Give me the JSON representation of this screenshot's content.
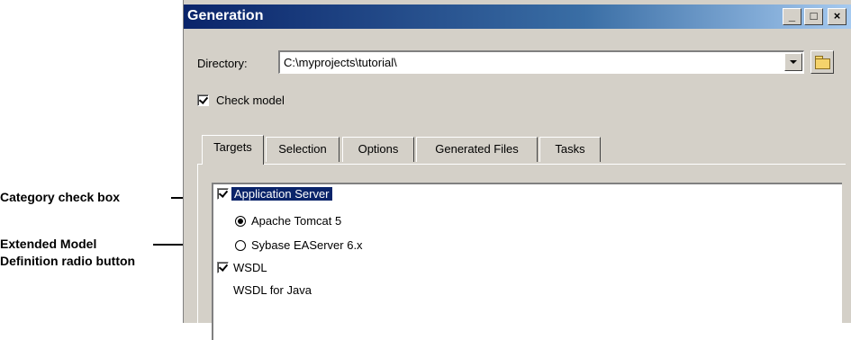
{
  "window": {
    "title": "Generation",
    "buttons": {
      "minimize": "_",
      "maximize": "□",
      "close": "×"
    }
  },
  "directory": {
    "label": "Directory:",
    "value": "C:\\myprojects\\tutorial\\"
  },
  "check_model": {
    "label": "Check model",
    "checked": true
  },
  "tabs": [
    {
      "label": "Targets",
      "active": true
    },
    {
      "label": "Selection",
      "active": false
    },
    {
      "label": "Options",
      "active": false
    },
    {
      "label": "Generated Files",
      "active": false
    },
    {
      "label": "Tasks",
      "active": false
    }
  ],
  "targets": {
    "items": [
      {
        "label": "Application Server",
        "type": "checkbox",
        "checked": true,
        "selected": true
      },
      {
        "label": "Apache Tomcat 5",
        "type": "radio",
        "checked": true
      },
      {
        "label": "Sybase EAServer 6.x",
        "type": "radio",
        "checked": false
      },
      {
        "label": "WSDL",
        "type": "checkbox",
        "checked": true
      },
      {
        "label": "WSDL for Java",
        "type": "text"
      }
    ]
  },
  "callouts": {
    "category_checkbox": "Category check box",
    "extended_model": "Extended Model Definition radio button"
  }
}
